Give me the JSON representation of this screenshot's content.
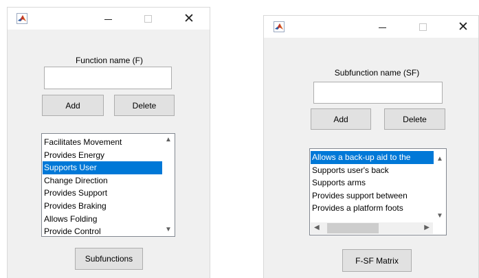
{
  "colors": {
    "selection": "#0078d7",
    "window_bg": "#f0f0f0",
    "titlebar_bg": "#ffffff"
  },
  "function_window": {
    "icon": "matlab-icon",
    "title_buttons": {
      "minimize": "minimize-icon",
      "maximize": "maximize-icon",
      "close": "close-icon"
    },
    "field_label": "Function name (F)",
    "field_value": "",
    "add_label": "Add",
    "delete_label": "Delete",
    "list_items": [
      "Facilitates Movement",
      "Provides Energy",
      "Supports User",
      "Change Direction",
      "Provides Support",
      "Provides Braking",
      "Allows Folding",
      "Provide Control"
    ],
    "selected_index": 2,
    "subfunctions_label": "Subfunctions"
  },
  "subfunction_window": {
    "icon": "matlab-icon",
    "field_label": "Subfunction name (SF)",
    "field_value": "",
    "add_label": "Add",
    "delete_label": "Delete",
    "list_items": [
      "Allows a back-up aid to the",
      "Supports user's back",
      "Supports arms",
      "Provides support between",
      "Provides a platform foots"
    ],
    "selected_index": 0,
    "matrix_label": "F-SF Matrix"
  }
}
